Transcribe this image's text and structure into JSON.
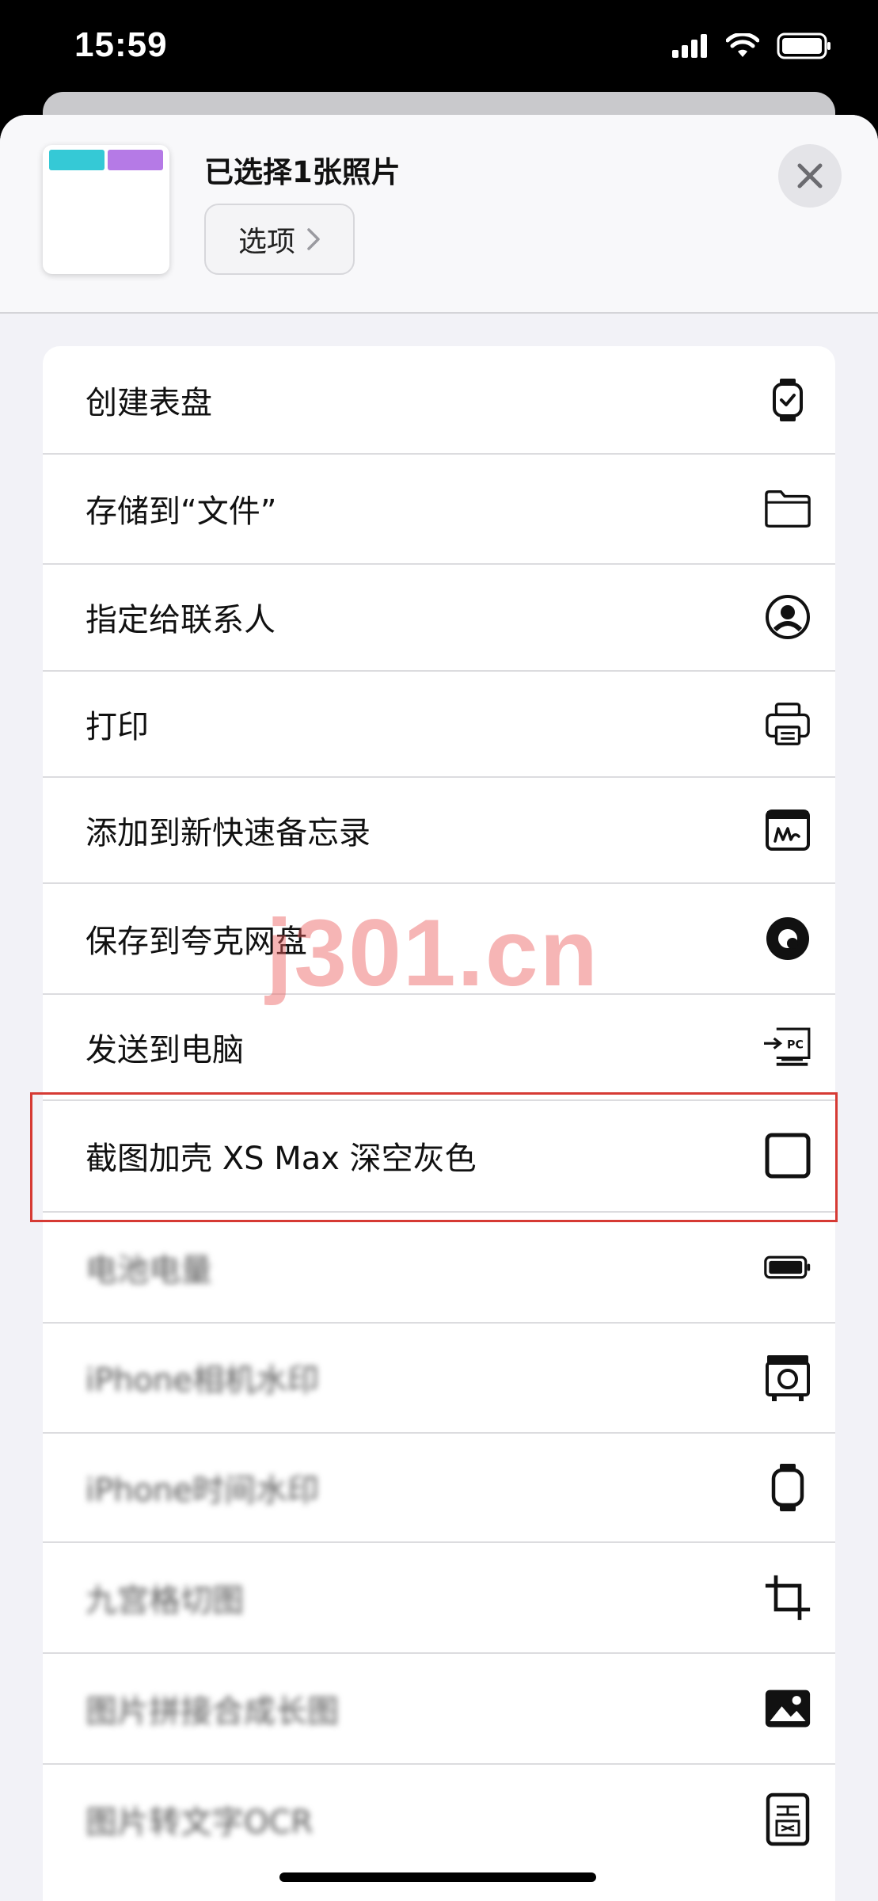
{
  "status_bar": {
    "time": "15:59"
  },
  "sheet_header": {
    "title": "已选择1张照片",
    "options_label": "选项"
  },
  "actions": [
    {
      "label": "创建表盘",
      "icon": "watch-icon",
      "blurred": false
    },
    {
      "label": "存储到“文件”",
      "icon": "folder-icon",
      "blurred": false
    },
    {
      "label": "指定给联系人",
      "icon": "person-circle-icon",
      "blurred": false
    },
    {
      "label": "打印",
      "icon": "printer-icon",
      "blurred": false
    },
    {
      "label": "添加到新快速备忘录",
      "icon": "quick-note-icon",
      "blurred": false
    },
    {
      "label": "保存到夸克网盘",
      "icon": "quark-icon",
      "blurred": false
    },
    {
      "label": "发送到电脑",
      "icon": "send-to-pc-icon",
      "blurred": false
    },
    {
      "label": "截图加壳 XS Max 深空灰色",
      "icon": "square-icon",
      "blurred": false
    },
    {
      "label": "电池电量",
      "icon": "battery-icon",
      "blurred": true
    },
    {
      "label": "iPhone相机水印",
      "icon": "camera-icon",
      "blurred": true
    },
    {
      "label": "iPhone时间水印",
      "icon": "watch-outline-icon",
      "blurred": true
    },
    {
      "label": "九宫格切图",
      "icon": "crop-icon",
      "blurred": true
    },
    {
      "label": "图片拼接合成长图",
      "icon": "photo-icon",
      "blurred": true
    },
    {
      "label": "图片转文字OCR",
      "icon": "text-recognition-icon",
      "blurred": true
    }
  ],
  "watermark": "j301.cn",
  "colors": {
    "highlight": "#d63a34",
    "watermark": "#ec5c5c",
    "accent_cyan": "#35c9d6",
    "accent_purple": "#b57ae6"
  }
}
